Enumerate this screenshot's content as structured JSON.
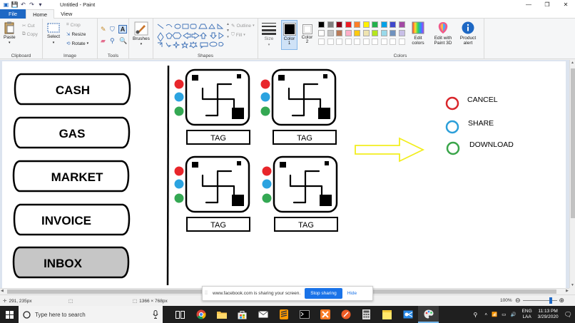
{
  "window": {
    "title": "Untitled - Paint",
    "controls": {
      "minimize": "—",
      "maximize": "❐",
      "close": "✕"
    }
  },
  "tabs": [
    {
      "label": "File"
    },
    {
      "label": "Home"
    },
    {
      "label": "View"
    }
  ],
  "ribbon": {
    "clipboard": {
      "paste": "Paste",
      "cut": "Cut",
      "copy": "Copy",
      "label": "Clipboard"
    },
    "image": {
      "select": "Select",
      "crop": "Crop",
      "resize": "Resize",
      "rotate": "Rotate",
      "label": "Image"
    },
    "tools": {
      "label": "Tools"
    },
    "brushes": {
      "label": "Brushes"
    },
    "shapes": {
      "outline": "Outline",
      "fill": "Fill",
      "label": "Shapes"
    },
    "size": {
      "label": "Size"
    },
    "color1": {
      "label": "Color",
      "num": "1",
      "value": "#000000"
    },
    "color2": {
      "label": "Color",
      "num": "2",
      "value": "#ffffff"
    },
    "colors": {
      "label": "Colors",
      "row1": [
        "#000000",
        "#7f7f7f",
        "#880015",
        "#ed1c24",
        "#ff7f27",
        "#fff200",
        "#22b14c",
        "#00a2e8",
        "#3f48cc",
        "#a349a4"
      ],
      "row2": [
        "#ffffff",
        "#c3c3c3",
        "#b97a57",
        "#ffaec9",
        "#ffc90e",
        "#efe4b0",
        "#b5e61d",
        "#99d9ea",
        "#7092be",
        "#c8bfe7"
      ],
      "row3": [
        "#ffffff",
        "#ffffff",
        "#ffffff",
        "#ffffff",
        "#ffffff",
        "#ffffff",
        "#ffffff",
        "#ffffff",
        "#ffffff",
        "#ffffff"
      ]
    },
    "edit_colors": {
      "line1": "Edit",
      "line2": "colors"
    },
    "paint3d": {
      "line1": "Edit with",
      "line2": "Paint 3D"
    },
    "alert": {
      "line1": "Product",
      "line2": "alert"
    }
  },
  "drawing": {
    "menu_buttons": [
      "CASH",
      "GAS",
      "MARKET",
      "INVOICE",
      "INBOX"
    ],
    "highlighted_button": "INBOX",
    "tag_label": "TAG",
    "legend": [
      {
        "label": "CANCEL",
        "color": "#d9262b"
      },
      {
        "label": "SHARE",
        "color": "#2c9fd9"
      },
      {
        "label": "DOWNLOAD",
        "color": "#3aa54a"
      }
    ],
    "dot_colors": {
      "red": "#e8262b",
      "blue": "#2ba3e0",
      "green": "#34a853"
    },
    "arrow_color": "#f2ee1e"
  },
  "status": {
    "cursor": "291, 235px",
    "dimensions": "1366 × 768px",
    "zoom": "100%"
  },
  "sharebar": {
    "message": "www.facebook.com is sharing your screen.",
    "stop_label": "Stop sharing",
    "hide_label": "Hide"
  },
  "taskbar": {
    "search_placeholder": "Type here to search",
    "lang_line1": "ENG",
    "lang_line2": "LAA",
    "time": "11:13 PM",
    "date": "3/29/2020"
  }
}
